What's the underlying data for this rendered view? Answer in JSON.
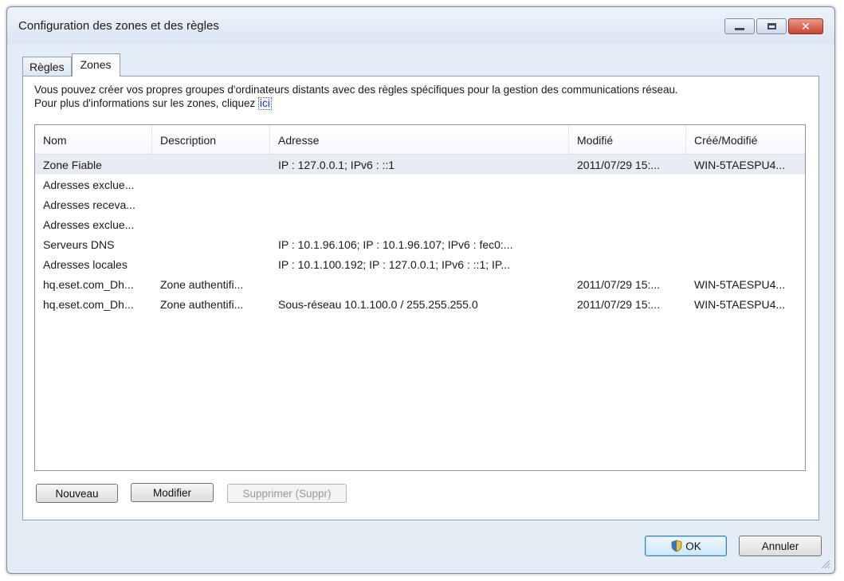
{
  "window": {
    "title": "Configuration des zones et des règles",
    "close_symbol": "✕"
  },
  "tabs": [
    {
      "label": "Règles",
      "active": false
    },
    {
      "label": "Zones",
      "active": true
    }
  ],
  "intro": {
    "line1": "Vous pouvez créer vos propres groupes d'ordinateurs distants avec des règles spécifiques pour la gestion des communications réseau.",
    "line2": "Pour plus d'informations sur les zones, cliquez ",
    "link": "ici"
  },
  "table": {
    "columns": [
      "Nom",
      "Description",
      "Adresse",
      "Modifié",
      "Créé/Modifié"
    ],
    "rows": [
      {
        "name": "Zone Fiable",
        "description": "",
        "address": "IP : 127.0.0.1; IPv6 : ::1",
        "modified": "2011/07/29 15:...",
        "created": "WIN-5TAESPU4...",
        "selected": true
      },
      {
        "name": "Adresses exclue...",
        "description": "",
        "address": "",
        "modified": "",
        "created": ""
      },
      {
        "name": "Adresses receva...",
        "description": "",
        "address": "",
        "modified": "",
        "created": ""
      },
      {
        "name": "Adresses exclue...",
        "description": "",
        "address": "",
        "modified": "",
        "created": ""
      },
      {
        "name": "Serveurs DNS",
        "description": "",
        "address": "IP : 10.1.96.106; IP : 10.1.96.107; IPv6 : fec0:...",
        "modified": "",
        "created": ""
      },
      {
        "name": "Adresses locales",
        "description": "",
        "address": "IP : 10.1.100.192; IP : 127.0.0.1; IPv6 : ::1; IP...",
        "modified": "",
        "created": ""
      },
      {
        "name": "hq.eset.com_Dh...",
        "description": "Zone authentifi...",
        "address": "",
        "modified": "2011/07/29 15:...",
        "created": "WIN-5TAESPU4..."
      },
      {
        "name": "hq.eset.com_Dh...",
        "description": "Zone authentifi...",
        "address": "Sous-réseau 10.1.100.0 / 255.255.255.0",
        "modified": "2011/07/29 15:...",
        "created": "WIN-5TAESPU4..."
      }
    ]
  },
  "buttons": {
    "new": "Nouveau",
    "edit": "Modifier",
    "delete": "Supprimer (Suppr)",
    "ok": "OK",
    "cancel": "Annuler"
  },
  "colors": {
    "window_bg": "#e4ecf6",
    "selected_row": "#e8ecf2",
    "close_button": "#c9452f"
  }
}
